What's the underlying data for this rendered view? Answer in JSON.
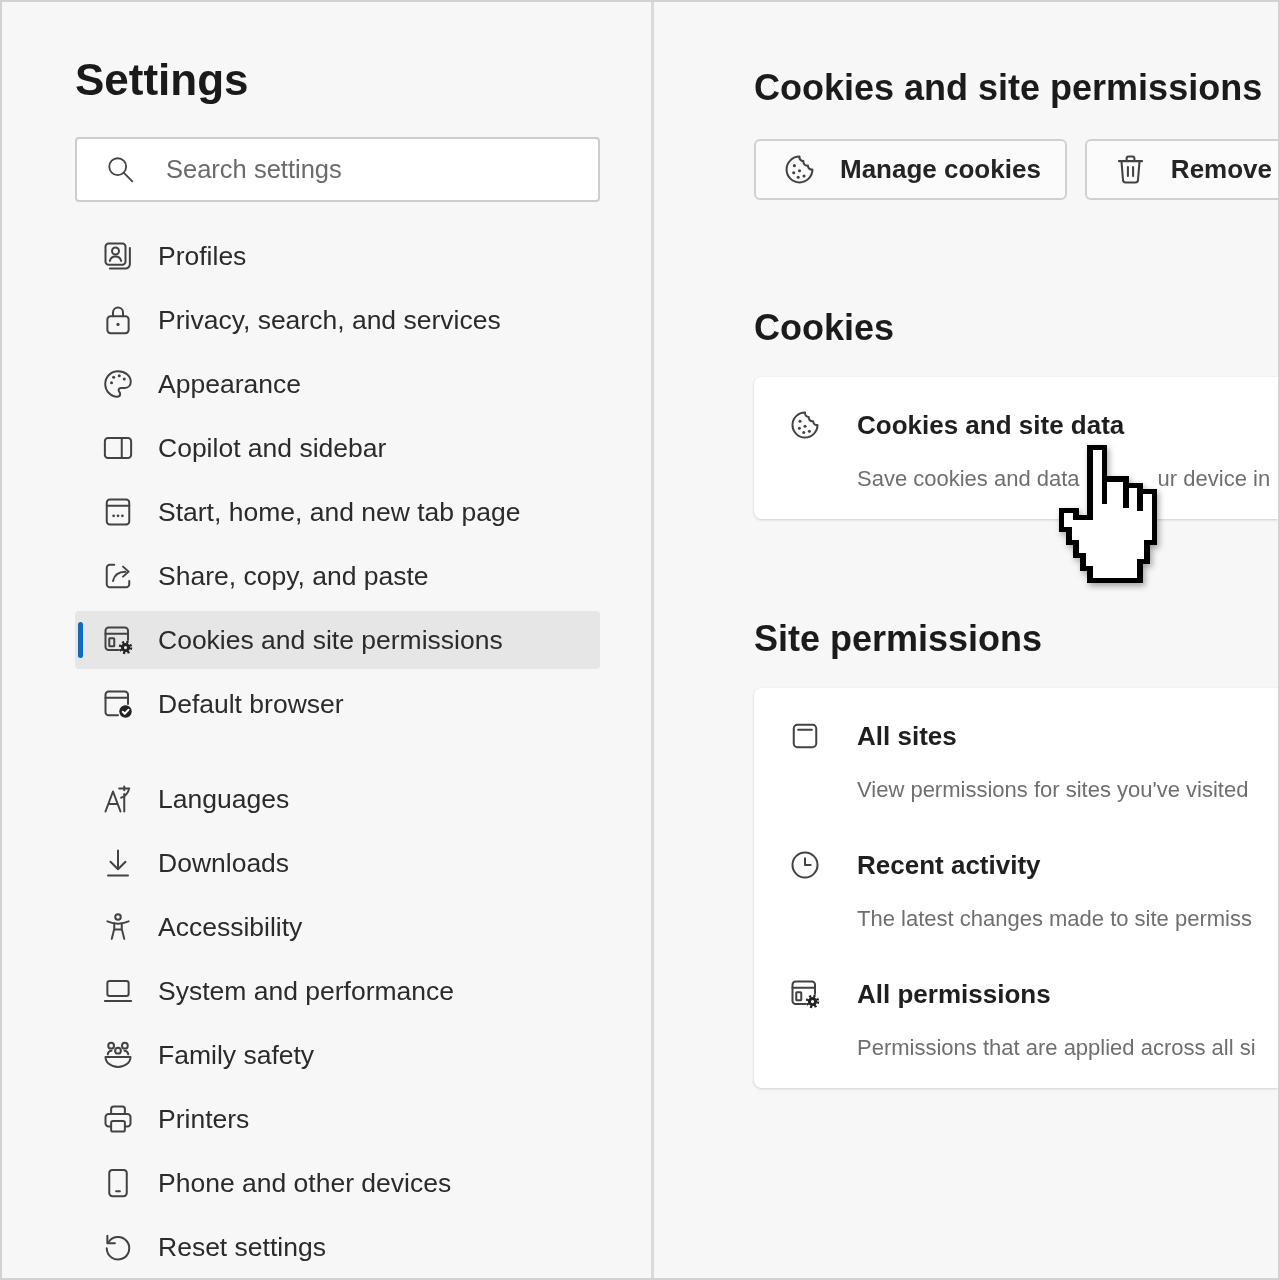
{
  "sidebar": {
    "title": "Settings",
    "search": {
      "placeholder": "Search settings"
    },
    "groups": [
      {
        "items": [
          {
            "label": "Profiles",
            "selected": false
          },
          {
            "label": "Privacy, search, and services",
            "selected": false
          },
          {
            "label": "Appearance",
            "selected": false
          },
          {
            "label": "Copilot and sidebar",
            "selected": false
          },
          {
            "label": "Start, home, and new tab page",
            "selected": false
          },
          {
            "label": "Share, copy, and paste",
            "selected": false
          },
          {
            "label": "Cookies and site permissions",
            "selected": true
          },
          {
            "label": "Default browser",
            "selected": false
          }
        ]
      },
      {
        "items": [
          {
            "label": "Languages",
            "selected": false
          },
          {
            "label": "Downloads",
            "selected": false
          },
          {
            "label": "Accessibility",
            "selected": false
          },
          {
            "label": "System and performance",
            "selected": false
          },
          {
            "label": "Family safety",
            "selected": false
          },
          {
            "label": "Printers",
            "selected": false
          },
          {
            "label": "Phone and other devices",
            "selected": false
          },
          {
            "label": "Reset settings",
            "selected": false
          }
        ]
      }
    ]
  },
  "content": {
    "title": "Cookies and site permissions",
    "buttons": [
      "Manage cookies",
      "Remove"
    ],
    "sections": [
      {
        "heading": "Cookies",
        "rows": [
          {
            "title": "Cookies and site data",
            "description": [
              "Save cookies and data",
              "ur device in"
            ]
          }
        ]
      },
      {
        "heading": "Site permissions",
        "rows": [
          {
            "title": "All sites",
            "description": [
              "View permissions for sites you've visited"
            ]
          },
          {
            "title": "Recent activity",
            "description": [
              "The latest changes made to site permiss"
            ]
          },
          {
            "title": "All permissions",
            "description": [
              "Permissions that are applied across all si"
            ]
          }
        ]
      }
    ]
  }
}
